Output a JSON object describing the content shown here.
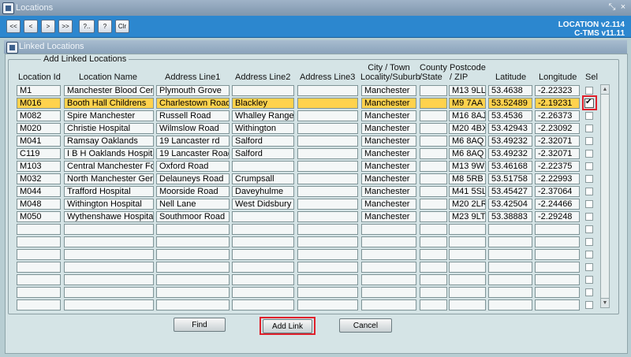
{
  "window": {
    "title": "Locations"
  },
  "toolbar": {
    "buttons": [
      "<<",
      "<",
      ">",
      ">>",
      "?..",
      "?",
      "Clr"
    ],
    "version_line1": "LOCATION v2.114",
    "version_line2": "C-TMS v11.11"
  },
  "dialog": {
    "title": "Linked Locations",
    "group_label": "Add Linked Locations"
  },
  "columns": {
    "location_id": "Location Id",
    "location_name": "Location Name",
    "address1": "Address Line1",
    "address2": "Address Line2",
    "address3": "Address Line3",
    "city1": "City / Town",
    "city2": "Locality/Suburb",
    "county1": "County",
    "county2": "/State",
    "post1": "Postcode",
    "post2": "/ ZIP",
    "latitude": "Latitude",
    "longitude": "Longitude",
    "sel": "Sel"
  },
  "rows": [
    {
      "id": "M1",
      "name": "Manchester Blood Cent",
      "a1": "Plymouth Grove",
      "a2": "",
      "a3": "",
      "city": "Manchester",
      "county": "",
      "post": "M13 9LL",
      "lat": "53.4638",
      "lon": "-2.22323",
      "sel": false
    },
    {
      "id": "M016",
      "name": "Booth Hall Childrens",
      "a1": "Charlestown Road",
      "a2": "Blackley",
      "a3": "",
      "city": "Manchester",
      "county": "",
      "post": "M9 7AA",
      "lat": "53.52489",
      "lon": "-2.19231",
      "sel": true
    },
    {
      "id": "M082",
      "name": "Spire Manchester",
      "a1": "Russell Road",
      "a2": "Whalley Range",
      "a3": "",
      "city": "Manchester",
      "county": "",
      "post": "M16 8AJ",
      "lat": "53.4536",
      "lon": "-2.26373",
      "sel": false
    },
    {
      "id": "M020",
      "name": "Christie Hospital",
      "a1": "Wilmslow Road",
      "a2": "Withington",
      "a3": "",
      "city": "Manchester",
      "county": "",
      "post": "M20 4BX",
      "lat": "53.42943",
      "lon": "-2.23092",
      "sel": false
    },
    {
      "id": "M041",
      "name": "Ramsay Oaklands",
      "a1": "19 Lancaster rd",
      "a2": "Salford",
      "a3": "",
      "city": "Manchester",
      "county": "",
      "post": "M6 8AQ",
      "lat": "53.49232",
      "lon": "-2.32071",
      "sel": false
    },
    {
      "id": "C119",
      "name": "I B H Oaklands Hospita",
      "a1": "19 Lancaster Road",
      "a2": "Salford",
      "a3": "",
      "city": "Manchester",
      "county": "",
      "post": "M6 8AQ",
      "lat": "53.49232",
      "lon": "-2.32071",
      "sel": false
    },
    {
      "id": "M103",
      "name": "Central Manchester Fou",
      "a1": "Oxford Road",
      "a2": "",
      "a3": "",
      "city": "Manchester",
      "county": "",
      "post": "M13 9WL",
      "lat": "53.46168",
      "lon": "-2.22375",
      "sel": false
    },
    {
      "id": "M032",
      "name": "North Manchester Gene",
      "a1": "Delauneys Road",
      "a2": "Crumpsall",
      "a3": "",
      "city": "Manchester",
      "county": "",
      "post": "M8 5RB",
      "lat": "53.51758",
      "lon": "-2.22993",
      "sel": false
    },
    {
      "id": "M044",
      "name": "Trafford Hospital",
      "a1": "Moorside Road",
      "a2": "Daveyhulme",
      "a3": "",
      "city": "Manchester",
      "county": "",
      "post": "M41 5SL",
      "lat": "53.45427",
      "lon": "-2.37064",
      "sel": false
    },
    {
      "id": "M048",
      "name": "Withington Hospital",
      "a1": "Nell Lane",
      "a2": "West Didsbury",
      "a3": "",
      "city": "Manchester",
      "county": "",
      "post": "M20 2LR",
      "lat": "53.42504",
      "lon": "-2.24466",
      "sel": false
    },
    {
      "id": "M050",
      "name": "Wythenshawe Hospital",
      "a1": "Southmoor Road",
      "a2": "",
      "a3": "",
      "city": "Manchester",
      "county": "",
      "post": "M23 9LT",
      "lat": "53.38883",
      "lon": "-2.29248",
      "sel": false
    },
    {
      "id": "",
      "name": "",
      "a1": "",
      "a2": "",
      "a3": "",
      "city": "",
      "county": "",
      "post": "",
      "lat": "",
      "lon": "",
      "sel": false
    },
    {
      "id": "",
      "name": "",
      "a1": "",
      "a2": "",
      "a3": "",
      "city": "",
      "county": "",
      "post": "",
      "lat": "",
      "lon": "",
      "sel": false
    },
    {
      "id": "",
      "name": "",
      "a1": "",
      "a2": "",
      "a3": "",
      "city": "",
      "county": "",
      "post": "",
      "lat": "",
      "lon": "",
      "sel": false
    },
    {
      "id": "",
      "name": "",
      "a1": "",
      "a2": "",
      "a3": "",
      "city": "",
      "county": "",
      "post": "",
      "lat": "",
      "lon": "",
      "sel": false
    },
    {
      "id": "",
      "name": "",
      "a1": "",
      "a2": "",
      "a3": "",
      "city": "",
      "county": "",
      "post": "",
      "lat": "",
      "lon": "",
      "sel": false
    },
    {
      "id": "",
      "name": "",
      "a1": "",
      "a2": "",
      "a3": "",
      "city": "",
      "county": "",
      "post": "",
      "lat": "",
      "lon": "",
      "sel": false
    },
    {
      "id": "",
      "name": "",
      "a1": "",
      "a2": "",
      "a3": "",
      "city": "",
      "county": "",
      "post": "",
      "lat": "",
      "lon": "",
      "sel": false
    }
  ],
  "selected_row_index": 1,
  "buttons": {
    "find": "Find",
    "add_link": "Add Link",
    "cancel": "Cancel"
  },
  "colors": {
    "toolbar": "#2c87cf",
    "selected_row": "#ffd24d",
    "highlight_box": "#e0202b"
  },
  "icons": {
    "app": "app-window-icon",
    "scroll_up": "arrow-up-icon",
    "scroll_down": "arrow-down-icon"
  }
}
